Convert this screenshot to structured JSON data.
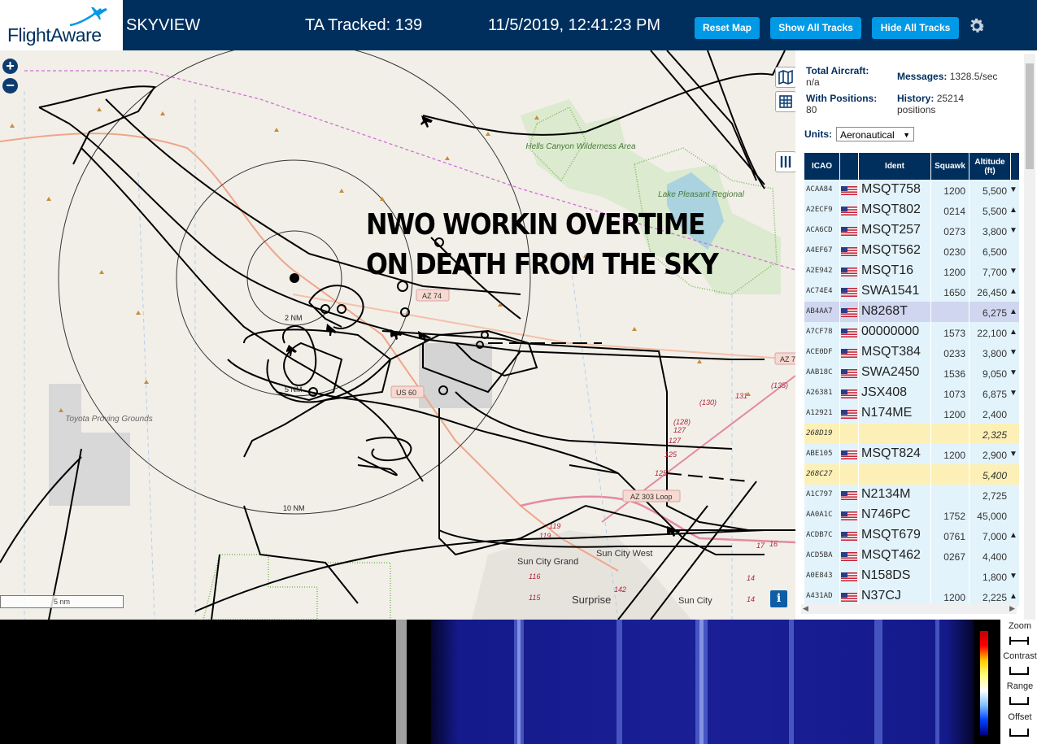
{
  "header": {
    "logo_text": "FlightAware",
    "app_name": "SKYVIEW",
    "tracked_label": "TA Tracked: 139",
    "datetime": "11/5/2019, 12:41:23 PM",
    "buttons": [
      "Reset Map",
      "Show All Tracks",
      "Hide All Tracks"
    ],
    "brand_color": "#002f5d",
    "button_color": "#0099e6"
  },
  "map": {
    "overlay_text": "NWO WORKIN OVERTIME ON DEATH FROM THE SKY",
    "scale_label": "5 nm",
    "range_rings": [
      "2 NM",
      "5 NM",
      "10 NM"
    ],
    "place_labels": [
      "Hells Canyon Wilderness Area",
      "Lake Pleasant Regional",
      "Toyota Proving Grounds",
      "Sun City Grand",
      "Sun City West",
      "Surprise",
      "Sun City"
    ],
    "road_labels": [
      "AZ 74",
      "US 60",
      "AZ 303 Loop",
      "AZ 7"
    ],
    "road_numbers": [
      "(135)",
      "(130)",
      "131",
      "(128)",
      "127",
      "127",
      "125",
      "125",
      "119",
      "119",
      "116",
      "115",
      "142",
      "17",
      "16",
      "14",
      "14"
    ],
    "info_label": "i"
  },
  "sidebar": {
    "total_label": "Total Aircraft:",
    "total_value": "n/a",
    "messages_label": "Messages:",
    "messages_value": "1328.5/sec",
    "positions_label": "With Positions:",
    "positions_value": "80",
    "history_label": "History:",
    "history_value": "25214",
    "history_unit": "positions",
    "units_label": "Units:",
    "units_value": "Aeronautical",
    "columns": [
      "ICAO",
      "",
      "Ident",
      "Squawk",
      "Altitude (ft)"
    ],
    "rows": [
      {
        "icao": "ACAA84",
        "ident": "MSQT758",
        "squawk": "1200",
        "alt": "5,500",
        "arrow": "▼",
        "style": ""
      },
      {
        "icao": "A2ECF9",
        "ident": "MSQT802",
        "squawk": "0214",
        "alt": "5,500",
        "arrow": "▲",
        "style": ""
      },
      {
        "icao": "ACA6CD",
        "ident": "MSQT257",
        "squawk": "0273",
        "alt": "3,800",
        "arrow": "▼",
        "style": ""
      },
      {
        "icao": "A4EF67",
        "ident": "MSQT562",
        "squawk": "0230",
        "alt": "6,500",
        "arrow": "",
        "style": ""
      },
      {
        "icao": "A2E942",
        "ident": "MSQT16",
        "squawk": "1200",
        "alt": "7,700",
        "arrow": "▼",
        "style": ""
      },
      {
        "icao": "AC74E4",
        "ident": "SWA1541",
        "squawk": "1650",
        "alt": "26,450",
        "arrow": "▲",
        "style": ""
      },
      {
        "icao": "AB4AA7",
        "ident": "N8268T",
        "squawk": "",
        "alt": "6,275",
        "arrow": "▲",
        "style": "sel"
      },
      {
        "icao": "A7CF78",
        "ident": "00000000",
        "squawk": "1573",
        "alt": "22,100",
        "arrow": "▲",
        "style": ""
      },
      {
        "icao": "ACE0DF",
        "ident": "MSQT384",
        "squawk": "0233",
        "alt": "3,800",
        "arrow": "▼",
        "style": ""
      },
      {
        "icao": "AAB18C",
        "ident": "SWA2450",
        "squawk": "1536",
        "alt": "9,050",
        "arrow": "▼",
        "style": ""
      },
      {
        "icao": "A26381",
        "ident": "JSX408",
        "squawk": "1073",
        "alt": "6,875",
        "arrow": "▼",
        "style": ""
      },
      {
        "icao": "A12921",
        "ident": "N174ME",
        "squawk": "1200",
        "alt": "2,400",
        "arrow": "",
        "style": ""
      },
      {
        "icao": "268D19",
        "ident": "",
        "squawk": "",
        "alt": "2,325",
        "arrow": "",
        "style": "yel"
      },
      {
        "icao": "ABE105",
        "ident": "MSQT824",
        "squawk": "1200",
        "alt": "2,900",
        "arrow": "▼",
        "style": ""
      },
      {
        "icao": "268C27",
        "ident": "",
        "squawk": "",
        "alt": "5,400",
        "arrow": "",
        "style": "yel"
      },
      {
        "icao": "A1C797",
        "ident": "N2134M",
        "squawk": "",
        "alt": "2,725",
        "arrow": "",
        "style": ""
      },
      {
        "icao": "AA0A1C",
        "ident": "N746PC",
        "squawk": "1752",
        "alt": "45,000",
        "arrow": "",
        "style": ""
      },
      {
        "icao": "ACDB7C",
        "ident": "MSQT679",
        "squawk": "0761",
        "alt": "7,000",
        "arrow": "▲",
        "style": ""
      },
      {
        "icao": "ACD5BA",
        "ident": "MSQT462",
        "squawk": "0267",
        "alt": "4,400",
        "arrow": "",
        "style": ""
      },
      {
        "icao": "A0E843",
        "ident": "N158DS",
        "squawk": "",
        "alt": "1,800",
        "arrow": "▼",
        "style": ""
      },
      {
        "icao": "A431AD",
        "ident": "N37CJ",
        "squawk": "1200",
        "alt": "2,225",
        "arrow": "▲",
        "style": ""
      }
    ]
  },
  "waterfall_controls": [
    "Zoom",
    "Contrast",
    "Range",
    "Offset"
  ]
}
